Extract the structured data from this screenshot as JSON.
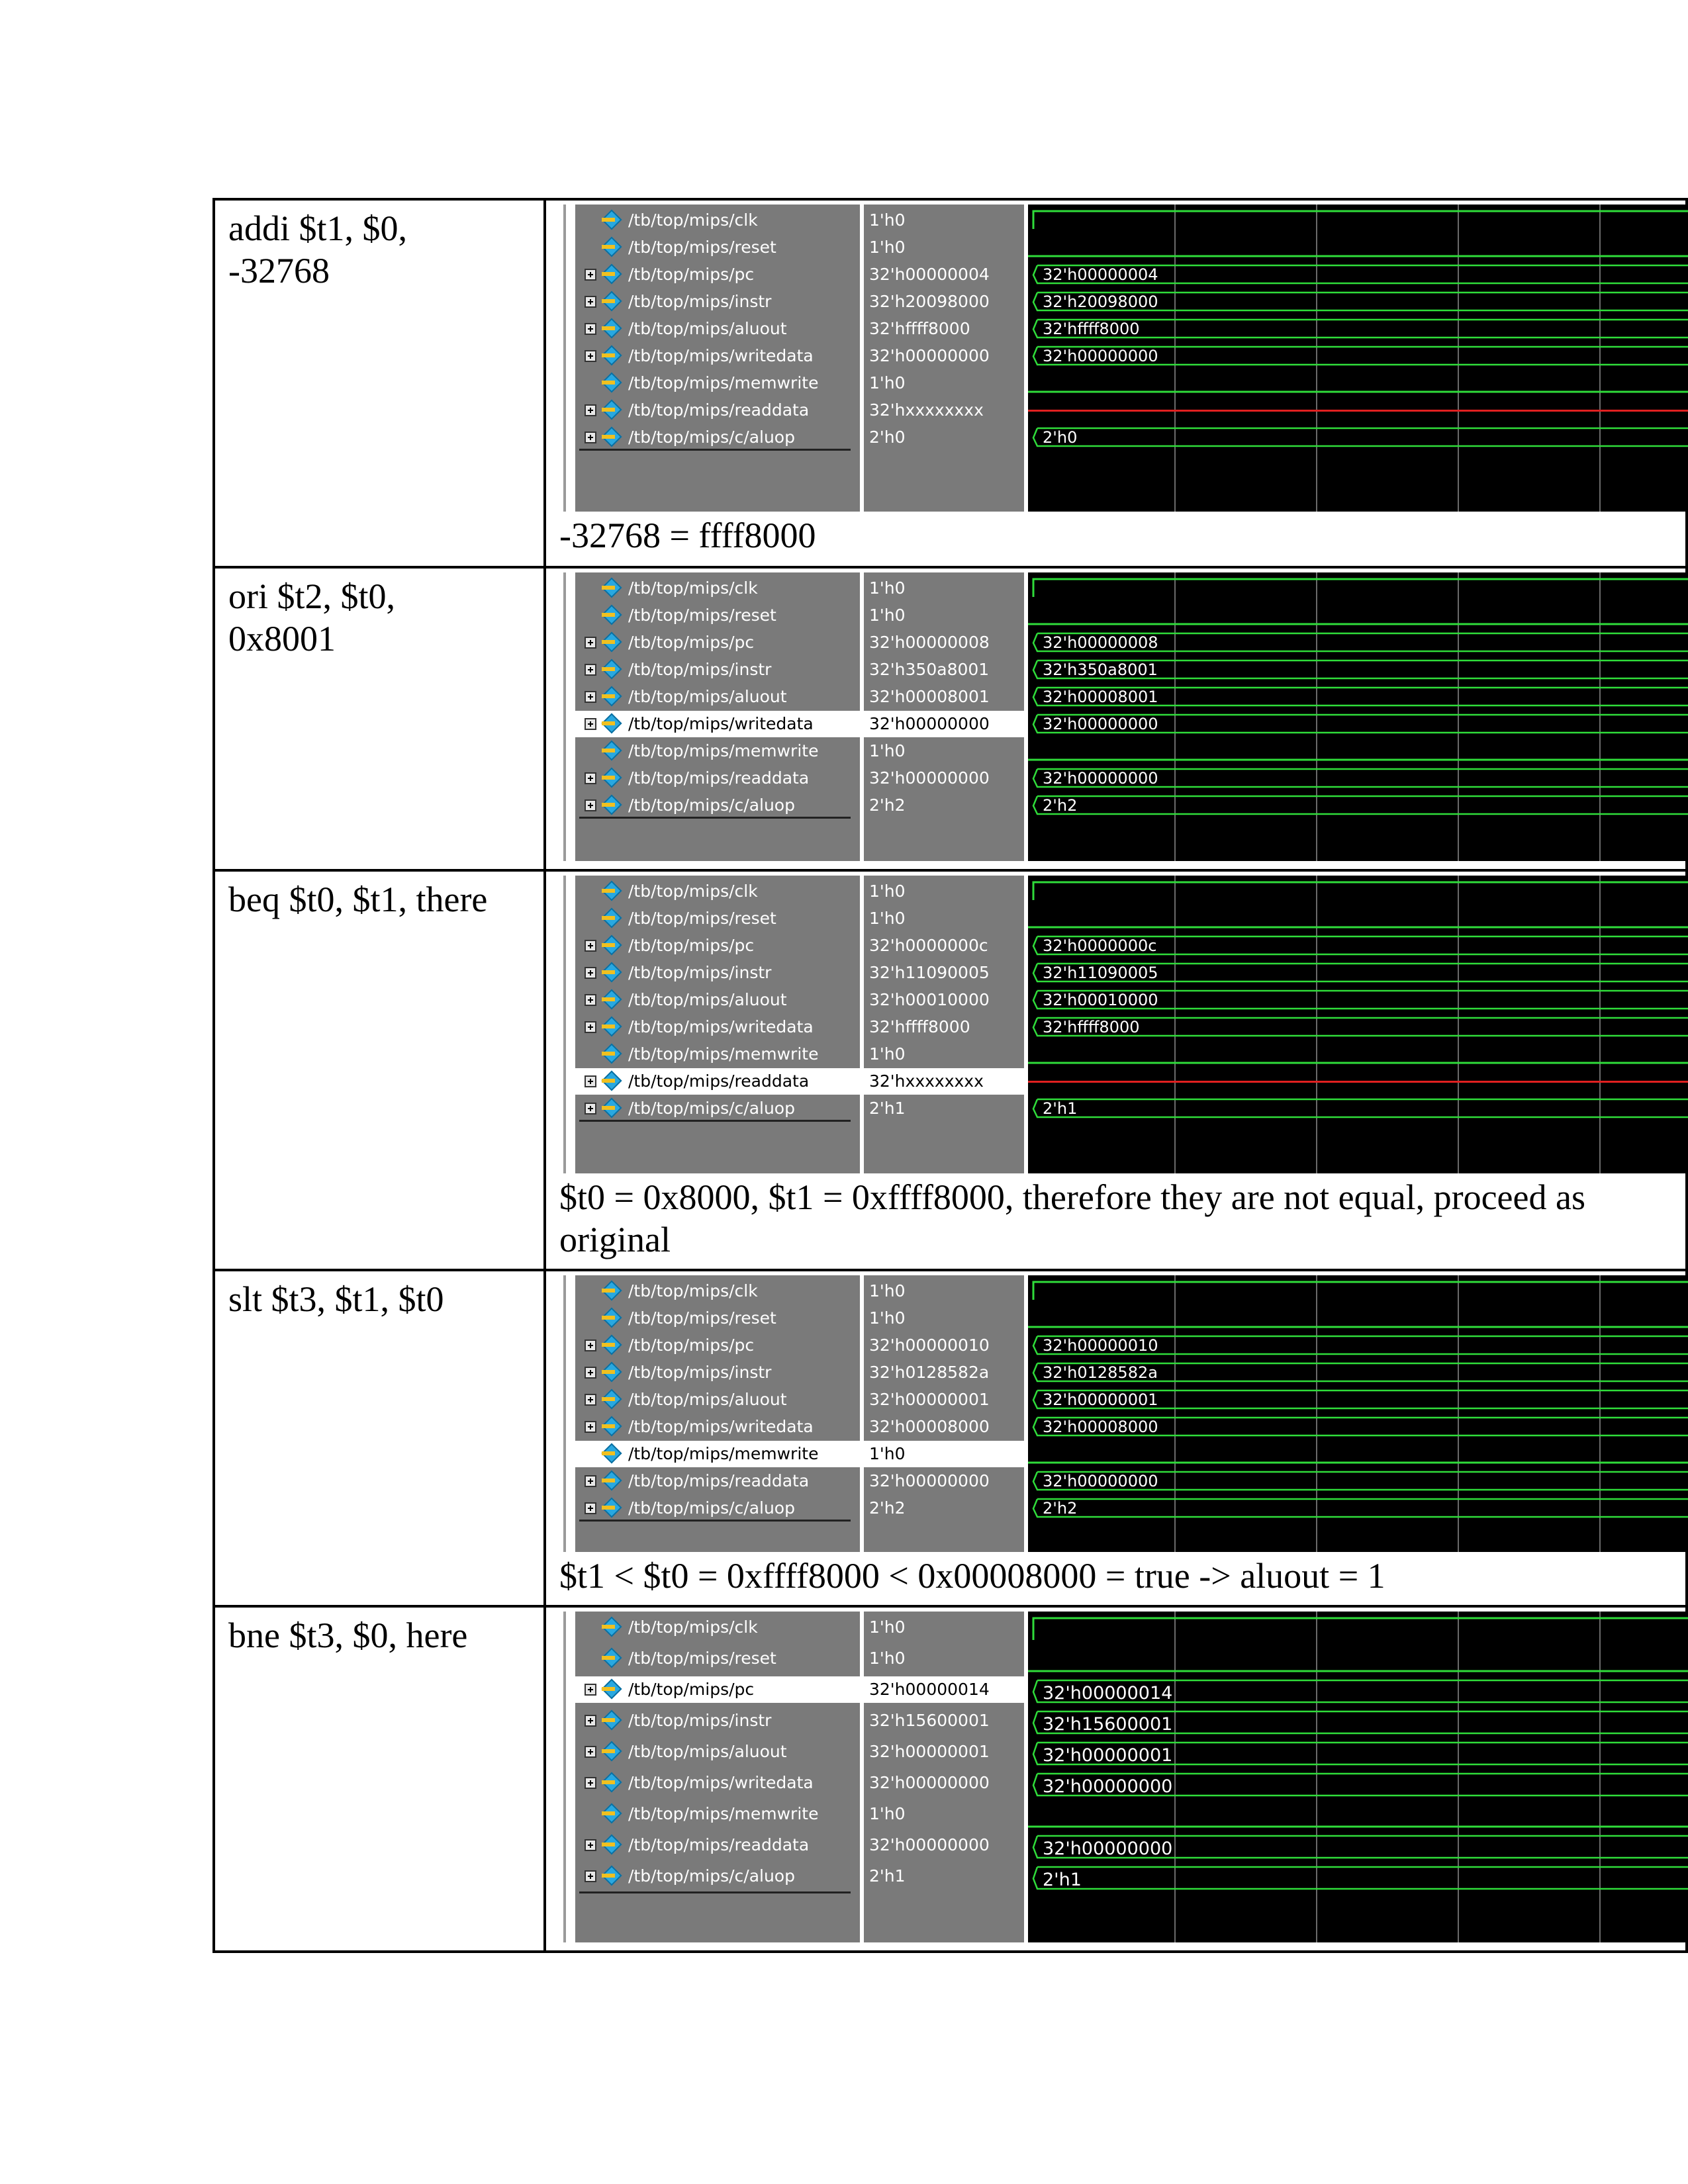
{
  "rows": [
    {
      "instruction": "addi $t1, $0,\n-32768",
      "caption": "-32768 = ffff8000",
      "signals": [
        {
          "name": "/tb/top/mips/clk",
          "value": "1'h0",
          "expandable": false,
          "wave": "clk"
        },
        {
          "name": "/tb/top/mips/reset",
          "value": "1'h0",
          "expandable": false,
          "wave": "low"
        },
        {
          "name": "/tb/top/mips/pc",
          "value": "32'h00000004",
          "expandable": true,
          "wave": "bus",
          "wave_label": "32'h00000004"
        },
        {
          "name": "/tb/top/mips/instr",
          "value": "32'h20098000",
          "expandable": true,
          "wave": "bus",
          "wave_label": "32'h20098000"
        },
        {
          "name": "/tb/top/mips/aluout",
          "value": "32'hffff8000",
          "expandable": true,
          "wave": "bus",
          "wave_label": "32'hffff8000"
        },
        {
          "name": "/tb/top/mips/writedata",
          "value": "32'h00000000",
          "expandable": true,
          "wave": "bus",
          "wave_label": "32'h00000000"
        },
        {
          "name": "/tb/top/mips/memwrite",
          "value": "1'h0",
          "expandable": false,
          "wave": "low"
        },
        {
          "name": "/tb/top/mips/readdata",
          "value": "32'hxxxxxxxx",
          "expandable": true,
          "wave": "x"
        },
        {
          "name": "/tb/top/mips/c/aluop",
          "value": "2'h0",
          "expandable": true,
          "wave": "bus",
          "wave_label": "2'h0"
        }
      ],
      "selected": -1
    },
    {
      "instruction": "ori $t2, $t0,\n0x8001",
      "caption": "",
      "signals": [
        {
          "name": "/tb/top/mips/clk",
          "value": "1'h0",
          "expandable": false,
          "wave": "clk"
        },
        {
          "name": "/tb/top/mips/reset",
          "value": "1'h0",
          "expandable": false,
          "wave": "low"
        },
        {
          "name": "/tb/top/mips/pc",
          "value": "32'h00000008",
          "expandable": true,
          "wave": "bus",
          "wave_label": "32'h00000008"
        },
        {
          "name": "/tb/top/mips/instr",
          "value": "32'h350a8001",
          "expandable": true,
          "wave": "bus",
          "wave_label": "32'h350a8001"
        },
        {
          "name": "/tb/top/mips/aluout",
          "value": "32'h00008001",
          "expandable": true,
          "wave": "bus",
          "wave_label": "32'h00008001"
        },
        {
          "name": "/tb/top/mips/writedata",
          "value": "32'h00000000",
          "expandable": true,
          "wave": "bus",
          "wave_label": "32'h00000000"
        },
        {
          "name": "/tb/top/mips/memwrite",
          "value": "1'h0",
          "expandable": false,
          "wave": "low"
        },
        {
          "name": "/tb/top/mips/readdata",
          "value": "32'h00000000",
          "expandable": true,
          "wave": "bus",
          "wave_label": "32'h00000000"
        },
        {
          "name": "/tb/top/mips/c/aluop",
          "value": "2'h2",
          "expandable": true,
          "wave": "bus",
          "wave_label": "2'h2"
        }
      ],
      "selected": 5
    },
    {
      "instruction": "beq $t0, $t1, there",
      "caption": "$t0 = 0x8000, $t1 = 0xffff8000, therefore they are not equal, proceed as\noriginal",
      "signals": [
        {
          "name": "/tb/top/mips/clk",
          "value": "1'h0",
          "expandable": false,
          "wave": "clk"
        },
        {
          "name": "/tb/top/mips/reset",
          "value": "1'h0",
          "expandable": false,
          "wave": "low"
        },
        {
          "name": "/tb/top/mips/pc",
          "value": "32'h0000000c",
          "expandable": true,
          "wave": "bus",
          "wave_label": "32'h0000000c"
        },
        {
          "name": "/tb/top/mips/instr",
          "value": "32'h11090005",
          "expandable": true,
          "wave": "bus",
          "wave_label": "32'h11090005"
        },
        {
          "name": "/tb/top/mips/aluout",
          "value": "32'h00010000",
          "expandable": true,
          "wave": "bus",
          "wave_label": "32'h00010000"
        },
        {
          "name": "/tb/top/mips/writedata",
          "value": "32'hffff8000",
          "expandable": true,
          "wave": "bus",
          "wave_label": "32'hffff8000"
        },
        {
          "name": "/tb/top/mips/memwrite",
          "value": "1'h0",
          "expandable": false,
          "wave": "low"
        },
        {
          "name": "/tb/top/mips/readdata",
          "value": "32'hxxxxxxxx",
          "expandable": true,
          "wave": "x"
        },
        {
          "name": "/tb/top/mips/c/aluop",
          "value": "2'h1",
          "expandable": true,
          "wave": "bus",
          "wave_label": "2'h1"
        }
      ],
      "selected": 7
    },
    {
      "instruction": "slt $t3, $t1, $t0",
      "caption": "$t1 < $t0 = 0xffff8000 < 0x00008000 = true -> aluout = 1",
      "signals": [
        {
          "name": "/tb/top/mips/clk",
          "value": "1'h0",
          "expandable": false,
          "wave": "clk"
        },
        {
          "name": "/tb/top/mips/reset",
          "value": "1'h0",
          "expandable": false,
          "wave": "low"
        },
        {
          "name": "/tb/top/mips/pc",
          "value": "32'h00000010",
          "expandable": true,
          "wave": "bus",
          "wave_label": "32'h00000010"
        },
        {
          "name": "/tb/top/mips/instr",
          "value": "32'h0128582a",
          "expandable": true,
          "wave": "bus",
          "wave_label": "32'h0128582a"
        },
        {
          "name": "/tb/top/mips/aluout",
          "value": "32'h00000001",
          "expandable": true,
          "wave": "bus",
          "wave_label": "32'h00000001"
        },
        {
          "name": "/tb/top/mips/writedata",
          "value": "32'h00008000",
          "expandable": true,
          "wave": "bus",
          "wave_label": "32'h00008000"
        },
        {
          "name": "/tb/top/mips/memwrite",
          "value": "1'h0",
          "expandable": false,
          "wave": "low"
        },
        {
          "name": "/tb/top/mips/readdata",
          "value": "32'h00000000",
          "expandable": true,
          "wave": "bus",
          "wave_label": "32'h00000000"
        },
        {
          "name": "/tb/top/mips/c/aluop",
          "value": "2'h2",
          "expandable": true,
          "wave": "bus",
          "wave_label": "2'h2"
        }
      ],
      "selected": 6
    },
    {
      "instruction": "bne $t3, $0, here",
      "caption": "",
      "signals": [
        {
          "name": "/tb/top/mips/clk",
          "value": "1'h0",
          "expandable": false,
          "wave": "clk"
        },
        {
          "name": "/tb/top/mips/reset",
          "value": "1'h0",
          "expandable": false,
          "wave": "low"
        },
        {
          "name": "/tb/top/mips/pc",
          "value": "32'h00000014",
          "expandable": true,
          "wave": "bus",
          "wave_label": "32'h00000014"
        },
        {
          "name": "/tb/top/mips/instr",
          "value": "32'h15600001",
          "expandable": true,
          "wave": "bus",
          "wave_label": "32'h15600001"
        },
        {
          "name": "/tb/top/mips/aluout",
          "value": "32'h00000001",
          "expandable": true,
          "wave": "bus",
          "wave_label": "32'h00000001"
        },
        {
          "name": "/tb/top/mips/writedata",
          "value": "32'h00000000",
          "expandable": true,
          "wave": "bus",
          "wave_label": "32'h00000000"
        },
        {
          "name": "/tb/top/mips/memwrite",
          "value": "1'h0",
          "expandable": false,
          "wave": "low"
        },
        {
          "name": "/tb/top/mips/readdata",
          "value": "32'h00000000",
          "expandable": true,
          "wave": "bus",
          "wave_label": "32'h00000000"
        },
        {
          "name": "/tb/top/mips/c/aluop",
          "value": "2'h1",
          "expandable": true,
          "wave": "bus",
          "wave_label": "2'h1"
        }
      ],
      "selected": 2
    }
  ],
  "colors": {
    "panel_gray": "#7a7a7a",
    "wave_bg": "#000000",
    "wave_green": "#2fdc3a",
    "wave_red": "#e02020",
    "grid": "#6a6a6a",
    "icon_blue": "#29a8e0",
    "icon_yellow": "#f0c020"
  }
}
